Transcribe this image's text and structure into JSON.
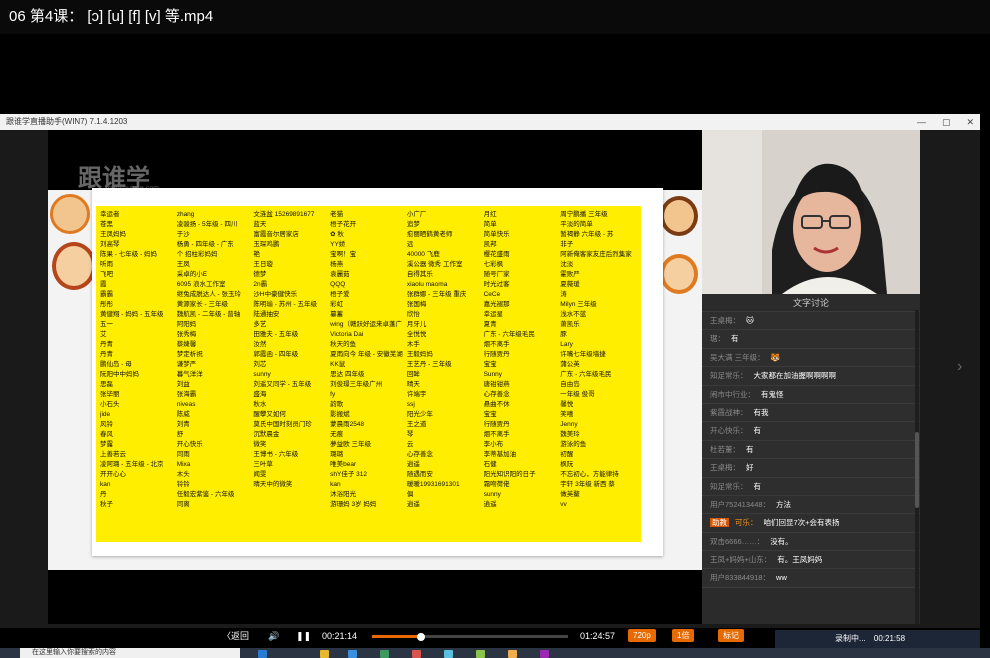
{
  "title": "06 第4课： [ɔ] [u] [f] [v] 等.mp4",
  "inner_window": {
    "title": "跟谁学直播助手(WIN7) 7.1.4.1203",
    "ctrl_min": "—",
    "ctrl_max": "▢",
    "ctrl_close": "✕"
  },
  "slide": {
    "logo": "跟谁学",
    "logo_sub": "genshuixue.com",
    "columns": [
      [
        "幸运者",
        "苍黑",
        "王凤妈妈",
        "刘高琴",
        "陈果 - 七年级 - 妈妈",
        "听雨",
        "飞吧",
        "霞",
        "霸霸",
        "彤彤",
        "黄健翔 - 妈妈 - 五年级",
        "五一",
        "艾",
        "丹青",
        "丹青",
        "鹏仙岛 - 母",
        "阮阳中中妈妈",
        "思磊",
        "张毕丽",
        "小石头",
        "jide",
        "风铃",
        "春风",
        "梦露",
        "上善若云",
        "凌阿璐 - 五年级 - 北京",
        "开开心心",
        "kan",
        "丹",
        "秋子"
      ],
      [
        "zhang",
        "凌骏扬 - 5年级 - 四川",
        "于沙",
        "杨勇 - 四年级 - 广东",
        "个 招柱彩妈妈",
        "王凤",
        "采卓的小E",
        "6095 浪水工作室",
        "继兔成脱达人 - 张玉玲",
        "黄源家长 - 三年级",
        "魏航凯 - 二年级 - 普轴",
        "阿阳妈",
        "张秀梅",
        "蔡婕馨",
        "梦定析祝",
        "谦梦严",
        "暮气洋洋",
        "刘益",
        "张海霸",
        "niveas",
        "陈威",
        "刘青",
        "舒",
        "开心快乐",
        "同雨",
        "Mixa",
        "木头",
        "铃铃",
        "任毅宏紫鉴 - 六年级",
        "同离"
      ],
      [
        "文涟盆 15269891677",
        "蓝天",
        "富霞音尔居家店",
        "玉琛鸡鹏",
        "艳",
        "王日璇",
        "",
        "德梦",
        "2n霸",
        "沙H中豪健快乐",
        "陈明瑜 - 苏州 - 五年级",
        "陆通抽安",
        "多艺",
        "田雅夫 - 五年级",
        "汝然",
        "郭霞函 - 四年级",
        "刘芯",
        "sunny",
        "刘遥又同学 - 五年级",
        "盛海",
        "秋水",
        "醒攀又如何",
        "莫氏中国时刻员门珍",
        "沉默晨金",
        "微笑",
        "王博书 - 六年级",
        "三叶草",
        "闻雯",
        "晴天中的微笑",
        ""
      ],
      [
        "老猫",
        "梧子花开",
        "✿ 秋",
        "YY娇",
        "宝啊！宝",
        "杨燕",
        "袁麗茹",
        "QQQ",
        "梧子爱",
        "彩虹",
        "纂蓄",
        "wing（赣跃好运来卓蓬广",
        "Victoria Dai",
        "秋天的鱼",
        "夏雨向今 年级 - 安徽芜湖",
        "KK鼠",
        "思达 四年级",
        "刘俊璟三年级广州",
        "fy",
        "韵歌",
        "影搬斌",
        "蒙晨雨2548",
        "无痕",
        "夢益欧 三年级",
        "璐璐",
        "唯美bear",
        "shY佳子 312",
        "kan",
        "沐浴阳光",
        "游珊妈 3岁 妈妈"
      ],
      [
        "小广厂",
        "追梦",
        "愈丽晒鹤黄老师",
        "远",
        "40000 飞鹿",
        "溪公器 微秀 工作室",
        "自得其乐",
        "xiaolu maoma",
        "张群娜 - 三年级 重庆",
        "张国梅",
        "欣怡",
        "月牙儿",
        "全悦悦",
        "木手",
        "王毅妈妈",
        "王艺丹 - 三年级",
        "回眸",
        "晴天",
        "许端宇",
        "ssj",
        "阳光少年",
        "王之道",
        "琴",
        "云",
        "心存善念",
        "逍遥",
        "随遇而安",
        "暖暖19931691301",
        "俱",
        "逍遥"
      ],
      [
        "月红",
        "简单",
        "简单快乐",
        "凯邦",
        "樱花盛雨",
        "七彩枫",
        "随号厂家",
        "时光过客",
        "CeCe",
        "嘉光褪那",
        "幸运星",
        "夏青",
        "广东 - 六年级毛民",
        "烟不离手",
        "行随贾丹",
        "宝宝",
        "Sunny",
        "唐钳钳燕",
        "心存善念",
        "悬曲不休",
        "宝宝",
        "行随贾丹",
        "烟不离手",
        "李小布",
        "李蒂基加油",
        "石健",
        "阳光知识阳的日子",
        "霜吻荷佬",
        "sunny",
        "逍遥"
      ]
    ],
    "col6b": [
      "周宁鹏播 三年级",
      "平淡的简单",
      "暂褐静 六年级 - 苏",
      "非子",
      "阿新俺客家友庄后烈集家",
      "沈淡",
      "霍败严",
      "夏薇瑗",
      "涛",
      "Milyn 三年级",
      "浅水不蓝",
      "萧凯乐",
      "豚",
      "Lary",
      "许嘴七年级墙捷",
      "蒲公英",
      "广东 - 六年级毛民",
      "自由岛",
      "一年级 俊哥",
      "馨悦",
      "笑嘻",
      "Jenny",
      "魏美玲",
      "游泳的鱼",
      "初醒",
      "枫阮",
      "不忘初心，方能律持",
      "宇轩 3年级 新西 蔡",
      "做英鳌",
      "vv"
    ]
  },
  "chat": {
    "title": "文字讨论",
    "messages": [
      {
        "user": "王桌梅：",
        "text": "🐱",
        "style": ""
      },
      {
        "user": "琚：",
        "text": "有",
        "style": ""
      },
      {
        "user": "吴大满 三年级：",
        "text": "🐯",
        "style": ""
      },
      {
        "user": "知足常乐：",
        "text": "大家都在加油握啊啊啊啊",
        "style": ""
      },
      {
        "user": "闹市中行业：",
        "text": "有鬼怪",
        "style": ""
      },
      {
        "user": "紫霞战神：",
        "text": "有我",
        "style": ""
      },
      {
        "user": "开心快乐：",
        "text": "有",
        "style": ""
      },
      {
        "user": "杜若董：",
        "text": "有",
        "style": ""
      },
      {
        "user": "王桌梅：",
        "text": "好",
        "style": ""
      },
      {
        "user": "知足常乐：",
        "text": "有",
        "style": ""
      },
      {
        "user": "用户752413448：",
        "text": "方法",
        "style": ""
      },
      {
        "user": "助教",
        "text": "咱们回显7次+会有表扬",
        "style": "hl",
        "user2": "可乐："
      },
      {
        "user": "双击6666……：",
        "text": "没有。",
        "style": ""
      },
      {
        "user": "王凤+妈妈+山东：",
        "text": "有。王凤妈妈",
        "style": ""
      },
      {
        "user": "用户833844918：",
        "text": "ww",
        "style": ""
      }
    ]
  },
  "controls": {
    "back": "〈返回",
    "volume_icon": "🔊",
    "pause_icon": "❚❚",
    "current_time": "00:21:14",
    "total_time": "01:24:57",
    "quality": "720p",
    "speed": "1倍",
    "mark": "标记",
    "progress": 0.25
  },
  "recording": {
    "text": "录制中...",
    "time": "00:21:58"
  },
  "taskbar": {
    "search": "在这里输入你要搜索的内容"
  }
}
